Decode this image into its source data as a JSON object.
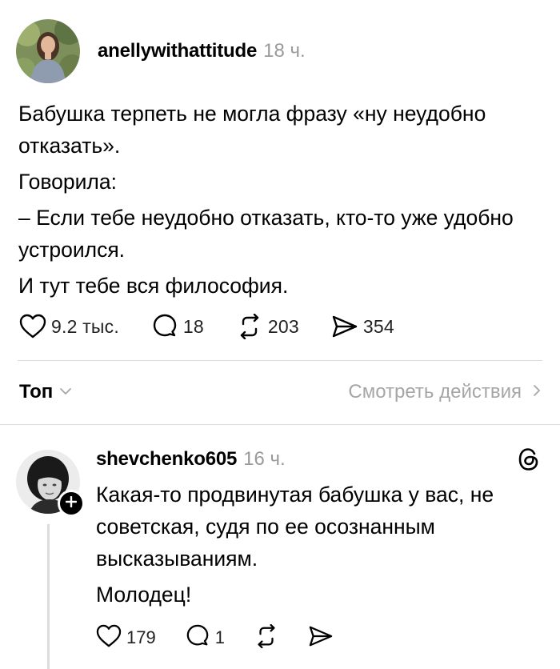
{
  "post": {
    "username": "anellywithattitude",
    "time": "18 ч.",
    "paragraphs": [
      "Бабушка терпеть не могла фразу «ну неудобно отказать».",
      "Говорила:",
      "– Если тебе неудобно отказать, кто-то уже удобно устроился.",
      "И тут тебе вся философия."
    ],
    "actions": {
      "likes": "9.2 тыс.",
      "comments": "18",
      "reposts": "203",
      "shares": "354"
    }
  },
  "sort": {
    "label": "Топ",
    "view_activity": "Смотреть действия"
  },
  "comment": {
    "username": "shevchenko605",
    "time": "16 ч.",
    "paragraphs": [
      "Какая-то продвинутая бабушка у вас, не советская, судя по ее осознанным высказываниям.",
      "Молодец!"
    ],
    "actions": {
      "likes": "179",
      "comments": "1"
    }
  },
  "icons": {
    "like": "heart-icon",
    "comment": "comment-bubble-icon",
    "repost": "repost-icon",
    "share": "send-icon",
    "threads": "threads-logo-icon",
    "follow": "plus-icon"
  }
}
